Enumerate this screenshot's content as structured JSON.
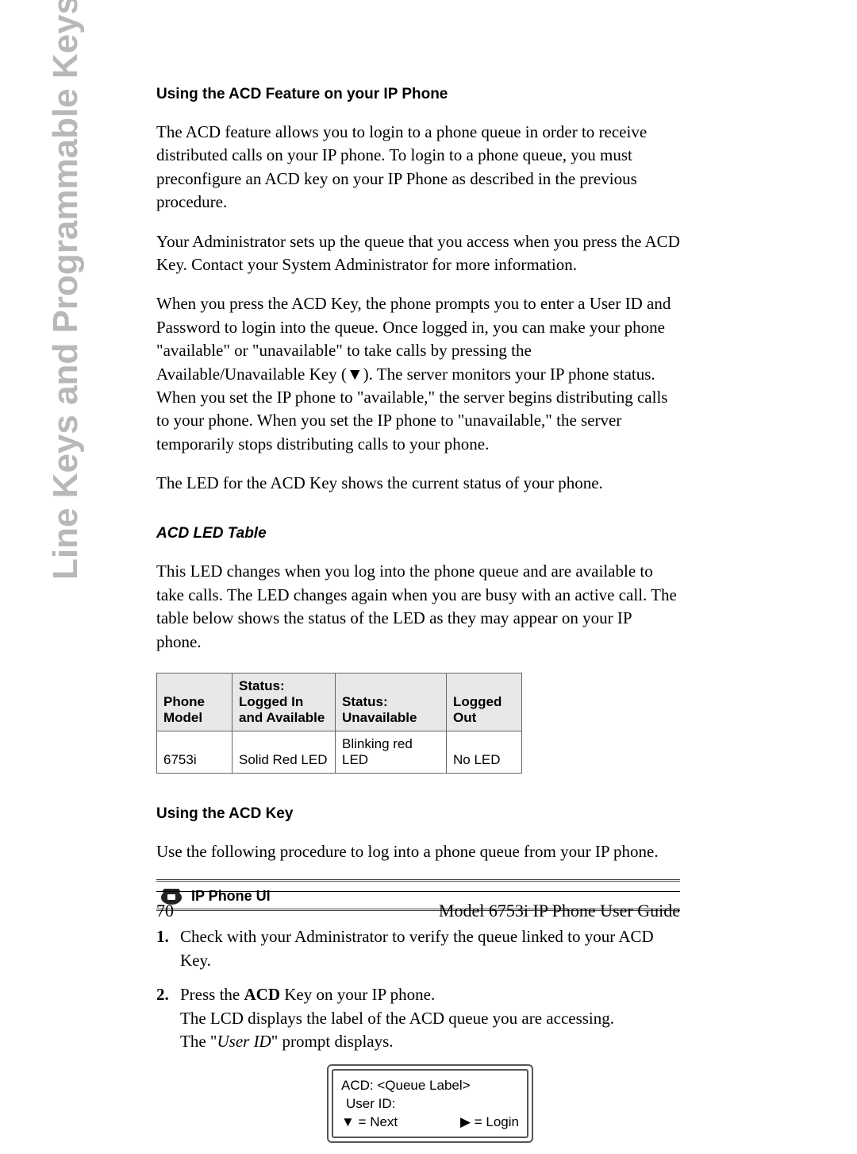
{
  "side_heading": "Line Keys and Programmable Keys",
  "section1": {
    "title": "Using the ACD Feature on your IP Phone",
    "p1": "The ACD feature allows you to login to a phone queue in order to receive distributed calls on your IP phone. To login to a phone queue, you must preconfigure an ACD key on your IP Phone as described in the previous procedure.",
    "p2": "Your Administrator sets up the queue that you access when you press the ACD Key. Contact your System Administrator for more information.",
    "p3a": "When you press the ACD Key, the phone prompts you to enter a User ID and Password to login into the queue. Once logged in, you can make your phone \"available\" or \"unavailable\" to take calls by pressing the Available/Unavailable Key (",
    "p3b": "). The server monitors your IP phone status. When you set the IP phone to \"available,\" the server begins distributing calls to your phone. When you set the IP phone to \"unavailable,\" the server temporarily stops distributing calls to your phone.",
    "p4": "The LED for the ACD Key shows the current status of your phone."
  },
  "section2": {
    "title": "ACD LED Table",
    "intro": "This LED changes when you log into the phone queue and are available to take calls. The LED changes again when you are busy with an active call. The table below shows the status of the LED as they may appear on your IP phone."
  },
  "table": {
    "headers": [
      "Phone Model",
      "Status: Logged In and Available",
      "Status: Unavailable",
      "Logged Out"
    ],
    "row": [
      "6753i",
      "Solid Red LED",
      "Blinking red LED",
      "No LED"
    ]
  },
  "section3": {
    "title": "Using the ACD Key",
    "intro": "Use the following procedure to log into a phone queue from your IP phone.",
    "ui_label": "IP Phone UI",
    "step1": "Check with your Administrator to verify the queue linked to your ACD Key.",
    "step2_a": "Press the ",
    "step2_b": "ACD",
    "step2_c": " Key on your IP phone.",
    "step2_d": "The LCD displays the label of the ACD queue you are accessing.",
    "step2_e1": "The \"",
    "step2_e2": "User ID",
    "step2_e3": "\" prompt displays."
  },
  "lcd": {
    "line1": "ACD: <Queue Label>",
    "line2": "User ID:",
    "next": " = Next",
    "login": " = Login"
  },
  "footer": {
    "page": "70",
    "title": "Model 6753i IP Phone User Guide"
  }
}
